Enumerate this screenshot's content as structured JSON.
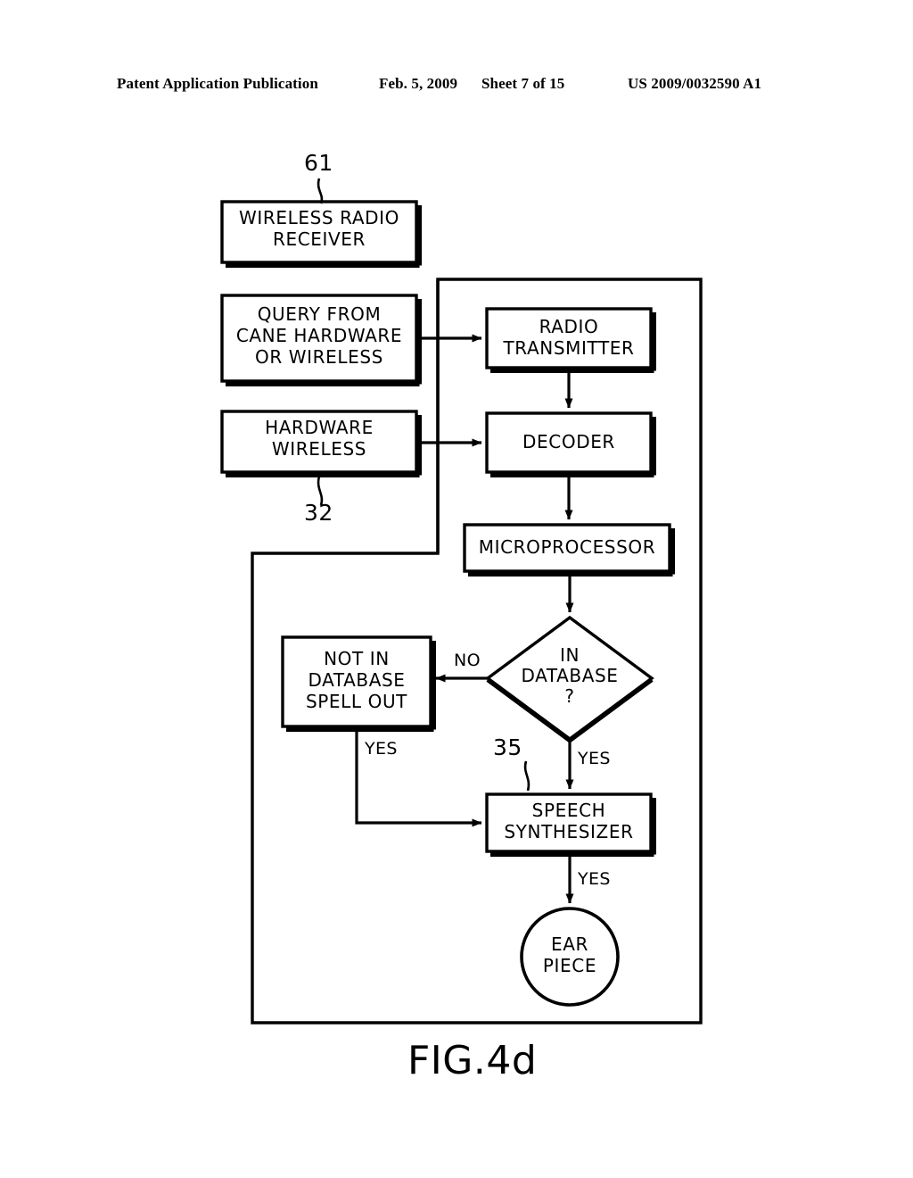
{
  "header": {
    "publication": "Patent Application Publication",
    "date": "Feb. 5, 2009",
    "sheet": "Sheet 7 of 15",
    "patent_number": "US 2009/0032590 A1"
  },
  "figure": {
    "caption": "FIG.4d",
    "nodes": {
      "wireless_radio_receiver": "WIRELESS RADIO\nRECEIVER",
      "query_from_cane": "QUERY FROM\nCANE HARDWARE\nOR WIRELESS",
      "hardware_wireless": "HARDWARE\nWIRELESS",
      "radio_transmitter": "RADIO\nTRANSMITTER",
      "decoder": "DECODER",
      "microprocessor": "MICROPROCESSOR",
      "in_database": "IN\nDATABASE\n?",
      "not_in_database": "NOT IN\nDATABASE\nSPELL OUT",
      "speech_synthesizer": "SPEECH\nSYNTHESIZER",
      "ear_piece": "EAR\nPIECE"
    },
    "reference_numerals": {
      "receiver": "61",
      "hardware_wireless": "32",
      "speech_synthesizer": "35"
    },
    "edge_labels": {
      "decision_no": "NO",
      "decision_yes": "YES",
      "spellout_yes": "YES",
      "synthesizer_yes": "YES"
    },
    "colors": {
      "ink": "#000000",
      "paper": "#ffffff"
    }
  }
}
